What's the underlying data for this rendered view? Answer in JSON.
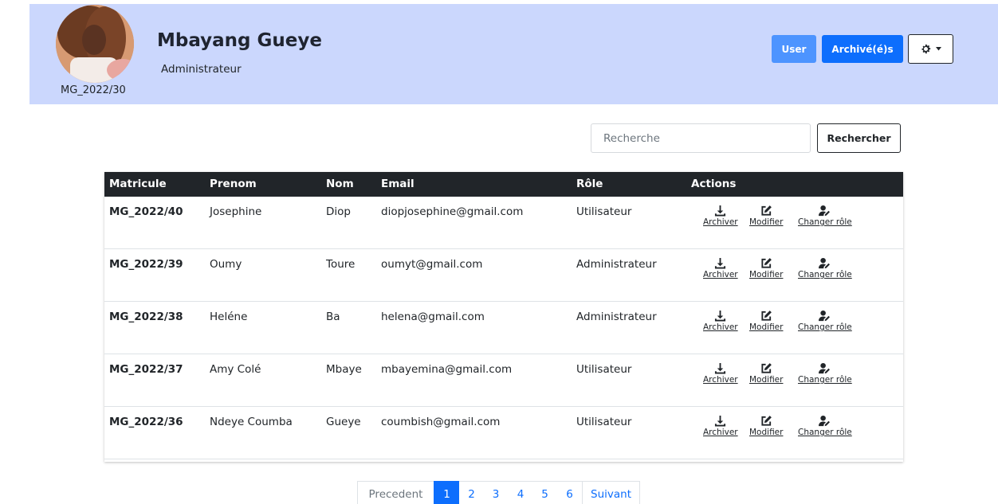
{
  "profile": {
    "name": "Mbayang Gueye",
    "role": "Administrateur",
    "matricule": "MG_2022/30"
  },
  "header_buttons": {
    "user": "User",
    "archived": "Archivé(é)s"
  },
  "search": {
    "placeholder": "Recherche",
    "button": "Rechercher"
  },
  "table": {
    "columns": [
      "Matricule",
      "Prenom",
      "Nom",
      "Email",
      "Rôle",
      "Actions"
    ],
    "rows": [
      {
        "matricule": "MG_2022/40",
        "prenom": "Josephine",
        "nom": "Diop",
        "email": "diopjosephine@gmail.com",
        "role": "Utilisateur"
      },
      {
        "matricule": "MG_2022/39",
        "prenom": "Oumy",
        "nom": "Toure",
        "email": "oumyt@gmail.com",
        "role": "Administrateur"
      },
      {
        "matricule": "MG_2022/38",
        "prenom": "Heléne",
        "nom": "Ba",
        "email": "helena@gmail.com",
        "role": "Administrateur"
      },
      {
        "matricule": "MG_2022/37",
        "prenom": "Amy Colé",
        "nom": "Mbaye",
        "email": "mbayemina@gmail.com",
        "role": "Utilisateur"
      },
      {
        "matricule": "MG_2022/36",
        "prenom": "Ndeye Coumba",
        "nom": "Gueye",
        "email": "coumbish@gmail.com",
        "role": "Utilisateur"
      }
    ],
    "actions": {
      "archive": "Archiver",
      "edit": "Modifier",
      "change_role": "Changer rôle"
    }
  },
  "pagination": {
    "prev": "Precedent",
    "pages": [
      "1",
      "2",
      "3",
      "4",
      "5",
      "6"
    ],
    "active": "1",
    "next": "Suivant"
  },
  "colors": {
    "header_bg": "#cbd7fd",
    "primary": "#0d6efd",
    "user_button": "#4d94ff",
    "table_head": "#212529"
  }
}
